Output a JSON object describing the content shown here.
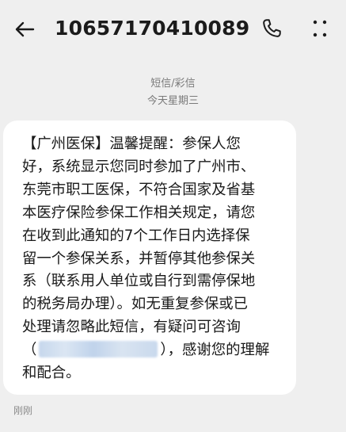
{
  "header": {
    "contact": "10657170410089",
    "icons": [
      "back-arrow-icon",
      "phone-icon",
      "more-vertical-icon"
    ]
  },
  "meta": {
    "type_label": "短信/彩信",
    "date_label": "今天星期三"
  },
  "message": {
    "lines": [
      "【广州医保】温馨提醒：参保人您",
      "好，系统显示您同时参加了广州市、",
      "东莞市职工医保，不符合国家及省基",
      "本医疗保险参保工作相关规定，请您",
      "在收到此通知的7个工作日内选择保",
      "留一个参保关系，并暂停其他参保关",
      "系（联系用人单位或自行到需停保地",
      "的税务局办理）。如无重复参保或已",
      "处理请忽略此短信，有疑问可咨询"
    ],
    "line10_prefix": "（",
    "line10_suffix": "），感谢您的理解",
    "line11": "和配合。"
  },
  "status": {
    "time_label": "刚刚"
  },
  "colors": {
    "background": "#efefef",
    "bubble": "#ffffff",
    "text": "#1a1a1a",
    "meta_text": "#7a7a7a"
  }
}
